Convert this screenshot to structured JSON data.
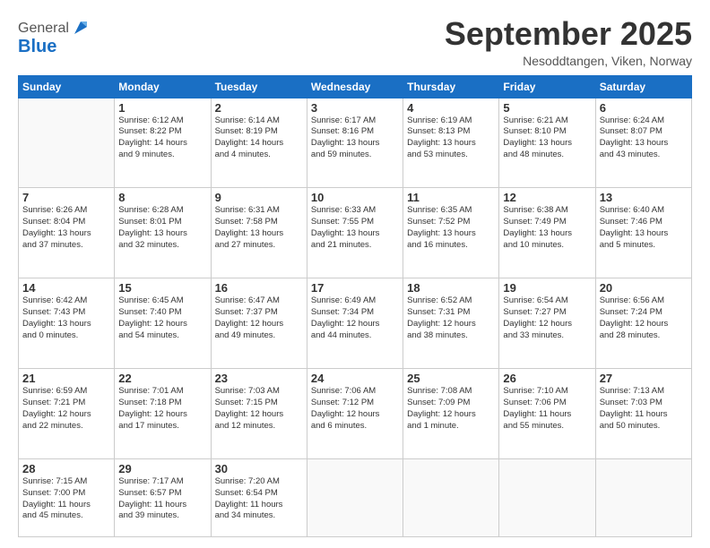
{
  "header": {
    "logo_general": "General",
    "logo_blue": "Blue",
    "month_title": "September 2025",
    "location": "Nesoddtangen, Viken, Norway"
  },
  "days_of_week": [
    "Sunday",
    "Monday",
    "Tuesday",
    "Wednesday",
    "Thursday",
    "Friday",
    "Saturday"
  ],
  "weeks": [
    [
      {
        "day": "",
        "info": ""
      },
      {
        "day": "1",
        "info": "Sunrise: 6:12 AM\nSunset: 8:22 PM\nDaylight: 14 hours\nand 9 minutes."
      },
      {
        "day": "2",
        "info": "Sunrise: 6:14 AM\nSunset: 8:19 PM\nDaylight: 14 hours\nand 4 minutes."
      },
      {
        "day": "3",
        "info": "Sunrise: 6:17 AM\nSunset: 8:16 PM\nDaylight: 13 hours\nand 59 minutes."
      },
      {
        "day": "4",
        "info": "Sunrise: 6:19 AM\nSunset: 8:13 PM\nDaylight: 13 hours\nand 53 minutes."
      },
      {
        "day": "5",
        "info": "Sunrise: 6:21 AM\nSunset: 8:10 PM\nDaylight: 13 hours\nand 48 minutes."
      },
      {
        "day": "6",
        "info": "Sunrise: 6:24 AM\nSunset: 8:07 PM\nDaylight: 13 hours\nand 43 minutes."
      }
    ],
    [
      {
        "day": "7",
        "info": "Sunrise: 6:26 AM\nSunset: 8:04 PM\nDaylight: 13 hours\nand 37 minutes."
      },
      {
        "day": "8",
        "info": "Sunrise: 6:28 AM\nSunset: 8:01 PM\nDaylight: 13 hours\nand 32 minutes."
      },
      {
        "day": "9",
        "info": "Sunrise: 6:31 AM\nSunset: 7:58 PM\nDaylight: 13 hours\nand 27 minutes."
      },
      {
        "day": "10",
        "info": "Sunrise: 6:33 AM\nSunset: 7:55 PM\nDaylight: 13 hours\nand 21 minutes."
      },
      {
        "day": "11",
        "info": "Sunrise: 6:35 AM\nSunset: 7:52 PM\nDaylight: 13 hours\nand 16 minutes."
      },
      {
        "day": "12",
        "info": "Sunrise: 6:38 AM\nSunset: 7:49 PM\nDaylight: 13 hours\nand 10 minutes."
      },
      {
        "day": "13",
        "info": "Sunrise: 6:40 AM\nSunset: 7:46 PM\nDaylight: 13 hours\nand 5 minutes."
      }
    ],
    [
      {
        "day": "14",
        "info": "Sunrise: 6:42 AM\nSunset: 7:43 PM\nDaylight: 13 hours\nand 0 minutes."
      },
      {
        "day": "15",
        "info": "Sunrise: 6:45 AM\nSunset: 7:40 PM\nDaylight: 12 hours\nand 54 minutes."
      },
      {
        "day": "16",
        "info": "Sunrise: 6:47 AM\nSunset: 7:37 PM\nDaylight: 12 hours\nand 49 minutes."
      },
      {
        "day": "17",
        "info": "Sunrise: 6:49 AM\nSunset: 7:34 PM\nDaylight: 12 hours\nand 44 minutes."
      },
      {
        "day": "18",
        "info": "Sunrise: 6:52 AM\nSunset: 7:31 PM\nDaylight: 12 hours\nand 38 minutes."
      },
      {
        "day": "19",
        "info": "Sunrise: 6:54 AM\nSunset: 7:27 PM\nDaylight: 12 hours\nand 33 minutes."
      },
      {
        "day": "20",
        "info": "Sunrise: 6:56 AM\nSunset: 7:24 PM\nDaylight: 12 hours\nand 28 minutes."
      }
    ],
    [
      {
        "day": "21",
        "info": "Sunrise: 6:59 AM\nSunset: 7:21 PM\nDaylight: 12 hours\nand 22 minutes."
      },
      {
        "day": "22",
        "info": "Sunrise: 7:01 AM\nSunset: 7:18 PM\nDaylight: 12 hours\nand 17 minutes."
      },
      {
        "day": "23",
        "info": "Sunrise: 7:03 AM\nSunset: 7:15 PM\nDaylight: 12 hours\nand 12 minutes."
      },
      {
        "day": "24",
        "info": "Sunrise: 7:06 AM\nSunset: 7:12 PM\nDaylight: 12 hours\nand 6 minutes."
      },
      {
        "day": "25",
        "info": "Sunrise: 7:08 AM\nSunset: 7:09 PM\nDaylight: 12 hours\nand 1 minute."
      },
      {
        "day": "26",
        "info": "Sunrise: 7:10 AM\nSunset: 7:06 PM\nDaylight: 11 hours\nand 55 minutes."
      },
      {
        "day": "27",
        "info": "Sunrise: 7:13 AM\nSunset: 7:03 PM\nDaylight: 11 hours\nand 50 minutes."
      }
    ],
    [
      {
        "day": "28",
        "info": "Sunrise: 7:15 AM\nSunset: 7:00 PM\nDaylight: 11 hours\nand 45 minutes."
      },
      {
        "day": "29",
        "info": "Sunrise: 7:17 AM\nSunset: 6:57 PM\nDaylight: 11 hours\nand 39 minutes."
      },
      {
        "day": "30",
        "info": "Sunrise: 7:20 AM\nSunset: 6:54 PM\nDaylight: 11 hours\nand 34 minutes."
      },
      {
        "day": "",
        "info": ""
      },
      {
        "day": "",
        "info": ""
      },
      {
        "day": "",
        "info": ""
      },
      {
        "day": "",
        "info": ""
      }
    ]
  ]
}
